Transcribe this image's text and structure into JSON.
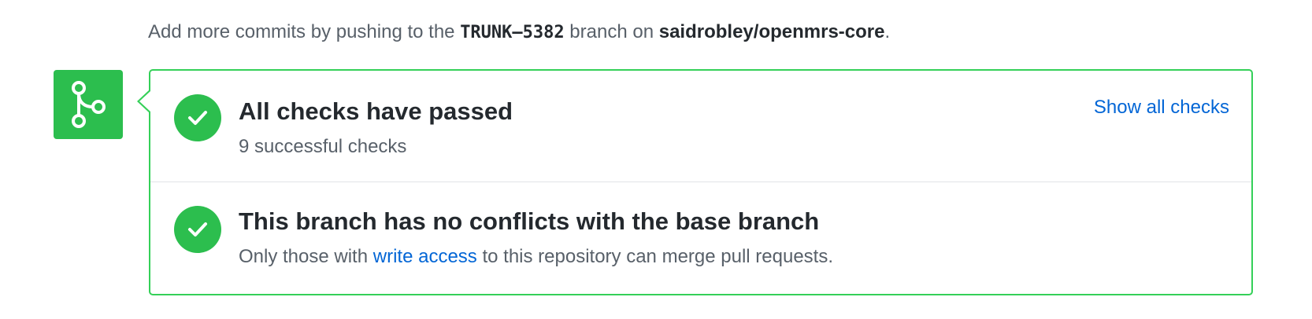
{
  "push_hint": {
    "prefix": "Add more commits by pushing to the ",
    "branch": "TRUNK–5382",
    "middle": " branch on ",
    "repo": "saidrobley/openmrs-core",
    "suffix": "."
  },
  "merge_icon": "git-merge-icon",
  "checks": {
    "title": "All checks have passed",
    "subtitle": "9 successful checks",
    "show_all_label": "Show all checks",
    "status_icon": "check-icon"
  },
  "conflicts": {
    "title": "This branch has no conflicts with the base branch",
    "subtitle_prefix": "Only those with ",
    "subtitle_link": "write access",
    "subtitle_suffix": " to this repository can merge pull requests.",
    "status_icon": "check-icon"
  },
  "colors": {
    "success_green": "#2cbe4e",
    "border_green": "#34d058",
    "link_blue": "#0366d6"
  }
}
